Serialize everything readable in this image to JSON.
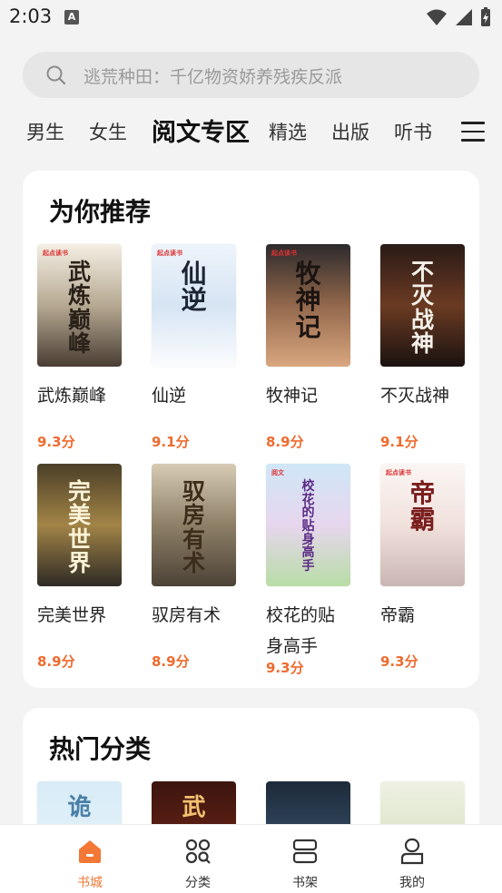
{
  "status_bar": {
    "time": "2:03",
    "a_label": "A"
  },
  "search": {
    "placeholder": "逃荒种田：千亿物资娇养残疾反派"
  },
  "tabs": [
    "男生",
    "女生",
    "阅文专区",
    "精选",
    "出版",
    "听书"
  ],
  "active_tab": "阅文专区",
  "recommend": {
    "title": "为你推荐",
    "books": [
      {
        "title": "武炼巅峰",
        "score": "9.3分",
        "cover_text": "武炼巅峰",
        "cover_colors": [
          "#f4efe4",
          "#b6a992",
          "#4a3d33"
        ],
        "text_color": "#2a2119",
        "pub": "起点读书"
      },
      {
        "title": "仙逆",
        "score": "9.1分",
        "cover_text": "仙逆",
        "cover_colors": [
          "#eef4fb",
          "#d6e4f3",
          "#fbfcfe"
        ],
        "text_color": "#1c2533",
        "pub": "起点读书"
      },
      {
        "title": "牧神记",
        "score": "8.9分",
        "cover_text": "牧神记",
        "cover_colors": [
          "#2c2a2c",
          "#93684c",
          "#d9a780"
        ],
        "text_color": "#1b1411",
        "pub": "起点读书"
      },
      {
        "title": "不灭战神",
        "score": "9.1分",
        "cover_text": "不灭战神",
        "cover_colors": [
          "#2a1a17",
          "#6b3b22",
          "#1a1210"
        ],
        "text_color": "#f4f1ea",
        "pub": ""
      },
      {
        "title": "完美世界",
        "score": "8.9分",
        "cover_text": "完美世界",
        "cover_colors": [
          "#4b3f27",
          "#a28447",
          "#2e2b25"
        ],
        "text_color": "#fff4d8",
        "pub": ""
      },
      {
        "title": "驭房有术",
        "score": "8.9分",
        "cover_text": "驭房有术",
        "cover_colors": [
          "#d7cbb5",
          "#8e8067",
          "#4c4236"
        ],
        "text_color": "#3c2c1a",
        "pub": ""
      },
      {
        "title": "校花的贴身高手",
        "score": "9.3分",
        "cover_text": "校花的贴身高手",
        "cover_colors": [
          "#cfe7f7",
          "#e7d6ee",
          "#b8dda6"
        ],
        "text_color": "#5b2a84",
        "pub": "阅文"
      },
      {
        "title": "帝霸",
        "score": "9.3分",
        "cover_text": "帝霸",
        "cover_colors": [
          "#fbf6f4",
          "#f1e1dc",
          "#c9b6b2"
        ],
        "text_color": "#7a1d1d",
        "pub": "起点读书"
      }
    ]
  },
  "hot": {
    "title": "热门分类",
    "covers": [
      {
        "cover_text": "诡",
        "cover_colors": [
          "#d8ecf7",
          "#eaf4fa"
        ],
        "text_color": "#4a7fa7"
      },
      {
        "cover_text": "武",
        "cover_colors": [
          "#3b150f",
          "#8b2c17"
        ],
        "text_color": "#f3c170"
      },
      {
        "cover_text": "",
        "cover_colors": [
          "#1d2a3a",
          "#4a6a88"
        ],
        "text_color": "#fff"
      },
      {
        "cover_text": "",
        "cover_colors": [
          "#eef1e4",
          "#c8d7a9"
        ],
        "text_color": "#2c3b22"
      }
    ]
  },
  "nav": [
    {
      "label": "书城",
      "icon": "home-icon",
      "active": true
    },
    {
      "label": "分类",
      "icon": "category-icon",
      "active": false
    },
    {
      "label": "书架",
      "icon": "bookshelf-icon",
      "active": false
    },
    {
      "label": "我的",
      "icon": "profile-icon",
      "active": false
    }
  ],
  "colors": {
    "accent": "#f37735",
    "score": "#ef6b2f",
    "background": "#f3f3f3"
  }
}
